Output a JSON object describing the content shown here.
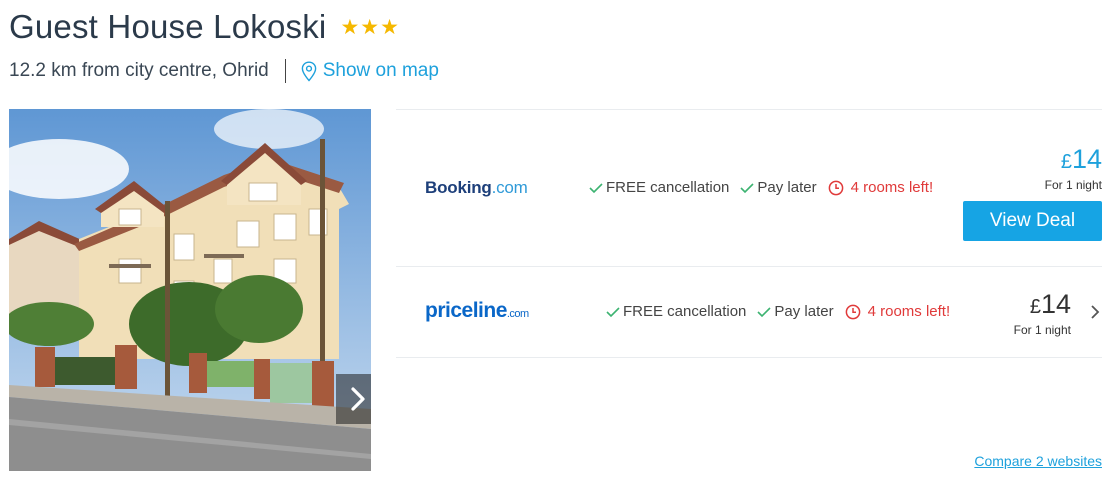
{
  "hotel": {
    "name": "Guest House Lokoski",
    "star_count": 3,
    "distance": "12.2 km from city centre, Ohrid",
    "map_link": "Show on map"
  },
  "offers": [
    {
      "provider": {
        "main": "Booking",
        "suffix": ".com"
      },
      "features": [
        "FREE cancellation",
        "Pay later"
      ],
      "rooms_left": "4 rooms left!",
      "currency": "£",
      "price": "14",
      "per_night": "For 1 night",
      "button": "View Deal"
    },
    {
      "provider": {
        "main": "priceline",
        "suffix": ".com"
      },
      "features": [
        "FREE cancellation",
        "Pay later"
      ],
      "rooms_left": "4 rooms left!",
      "currency": "£",
      "price": "14",
      "per_night": "For 1 night"
    }
  ],
  "compare_link": "Compare 2 websites",
  "colors": {
    "accent": "#1ea1dc",
    "star": "#f5b800",
    "check": "#3cb371",
    "urgent": "#e03a3a",
    "button": "#16a4e4"
  },
  "icons": [
    "star-icon",
    "map-pin-icon",
    "chevron-right-icon",
    "check-icon",
    "clock-icon"
  ]
}
